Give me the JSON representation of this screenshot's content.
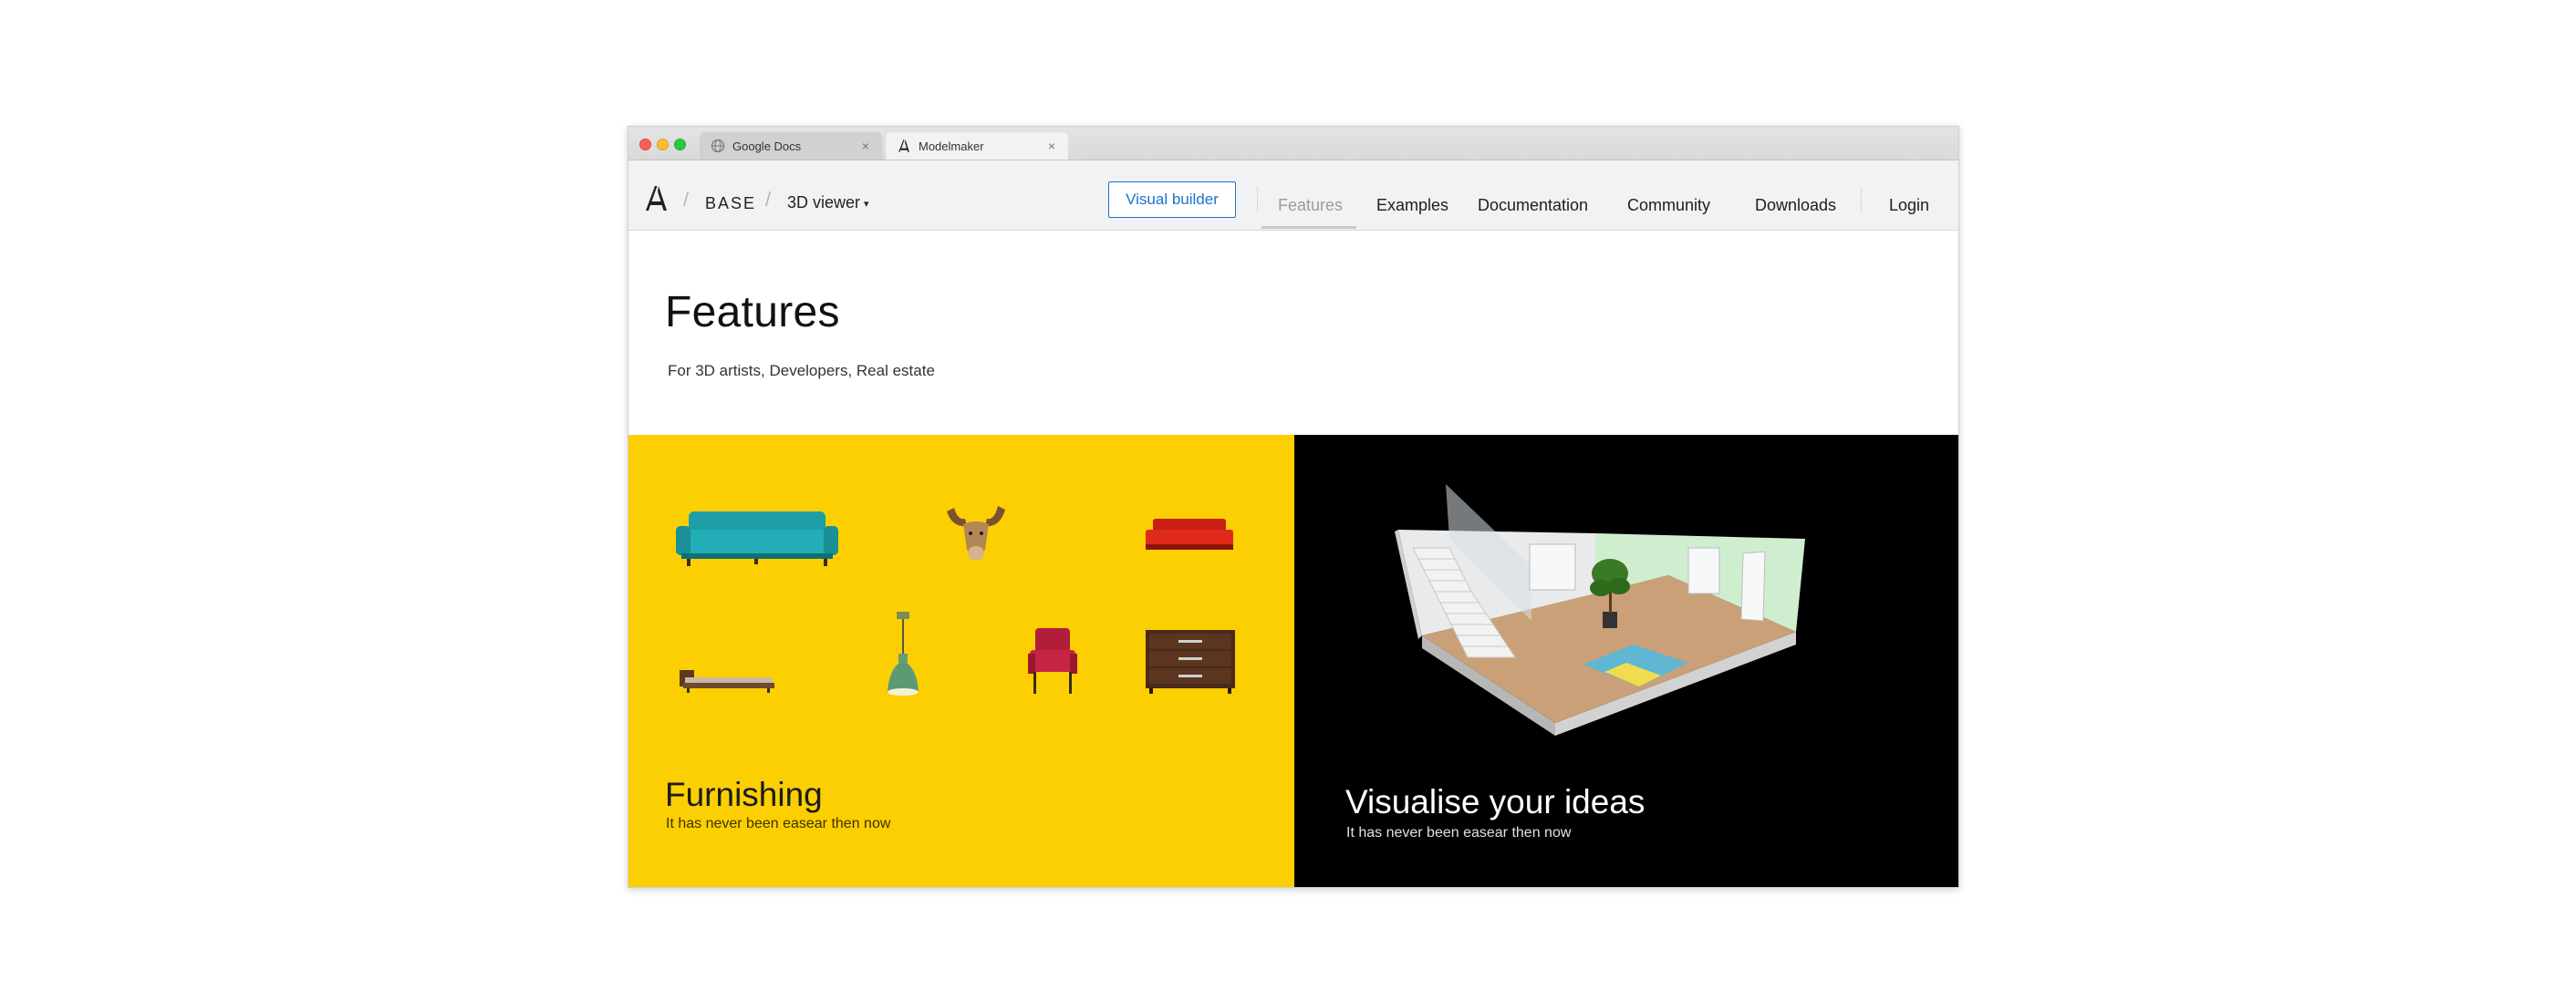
{
  "browser": {
    "tabs": [
      {
        "title": "Google Docs",
        "active": false,
        "icon": "globe-icon"
      },
      {
        "title": "Modelmaker",
        "active": true,
        "icon": "modelmaker-logo-icon"
      }
    ],
    "close_glyph": "×"
  },
  "nav": {
    "brand_icon": "modelmaker-logo-icon",
    "breadcrumb": [
      "BASE",
      "3D viewer"
    ],
    "caret": "▾",
    "cta_label": "Visual builder",
    "links": [
      "Features",
      "Examples",
      "Documentation",
      "Community",
      "Downloads"
    ],
    "active_link": "Features",
    "login_label": "Login",
    "accent_color": "#1a73c8"
  },
  "hero": {
    "title": "Features",
    "subtitle": "For 3D artists, Developers, Real estate"
  },
  "panels": [
    {
      "title": "Furnishing",
      "subtitle": "It has never been easear then now",
      "background": "#fccf02",
      "items": [
        "sofa",
        "moose-head",
        "red-sofa",
        "daybed",
        "pendant-lamp",
        "armchair",
        "dresser"
      ]
    },
    {
      "title": "Visualise your ideas",
      "subtitle": "It has never been easear then now",
      "background": "#000000",
      "image": "3d-room-render"
    }
  ]
}
